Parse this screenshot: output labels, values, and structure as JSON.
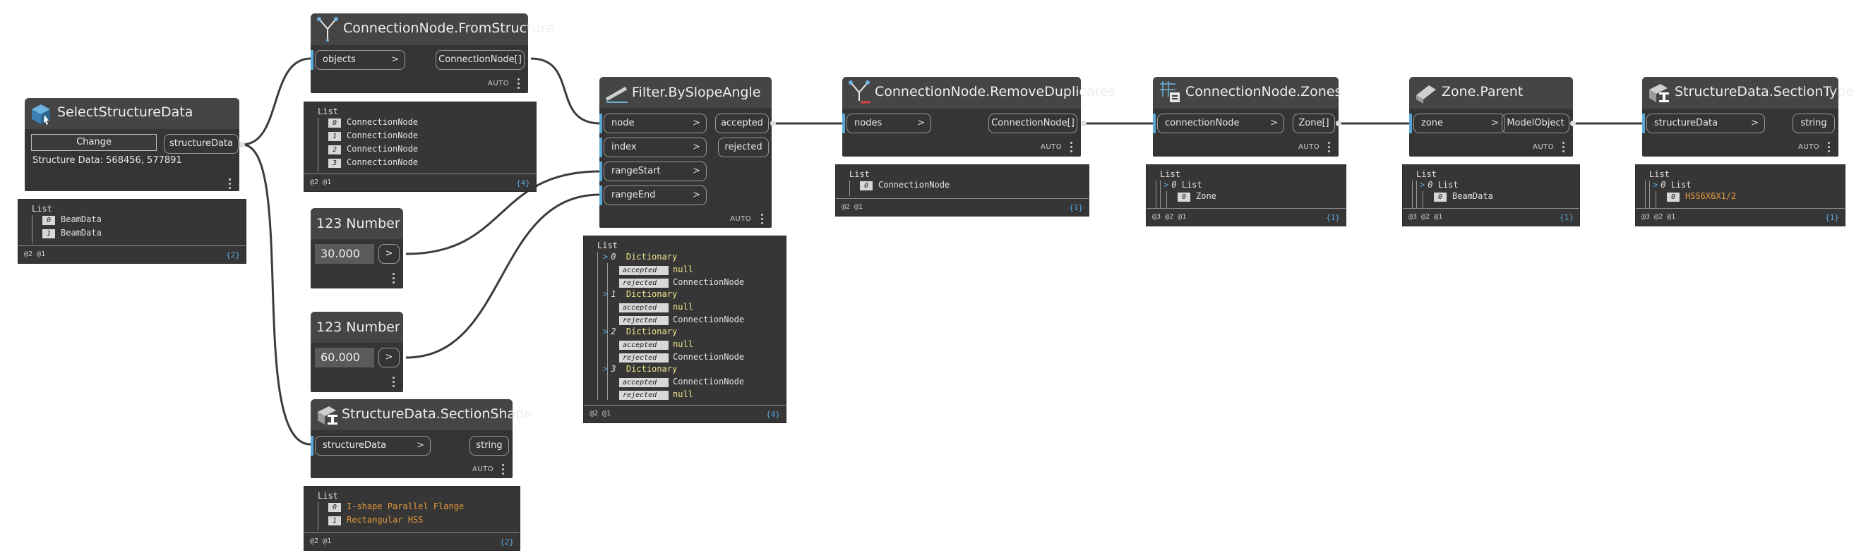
{
  "nodes": {
    "select_structure": {
      "title": "SelectStructureData",
      "button": "Change",
      "output": "structureData",
      "info": "Structure Data: 568456, 577891"
    },
    "from_structure": {
      "title": "ConnectionNode.FromStructure",
      "input": "objects",
      "output": "ConnectionNode[]",
      "lacing": "AUTO"
    },
    "number1": {
      "title": "123 Number",
      "value": "30.000",
      "output": ">"
    },
    "number2": {
      "title": "123 Number",
      "value": "60.000",
      "output": ">"
    },
    "section_shape": {
      "title": "StructureData.SectionShape",
      "input": "structureData",
      "output": "string",
      "lacing": "AUTO"
    },
    "filter": {
      "title": "Filter.BySlopeAngle",
      "inputs": [
        "node",
        "index",
        "rangeStart",
        "rangeEnd"
      ],
      "outputs": [
        "accepted",
        "rejected"
      ],
      "lacing": "AUTO"
    },
    "remove_dups": {
      "title": "ConnectionNode.RemoveDuplicates",
      "input": "nodes",
      "output": "ConnectionNode[]",
      "lacing": "AUTO"
    },
    "zones": {
      "title": "ConnectionNode.Zones",
      "input": "connectionNode",
      "output": "Zone[]",
      "lacing": "AUTO"
    },
    "zone_parent": {
      "title": "Zone.Parent",
      "input": "zone",
      "output": "ModelObject",
      "lacing": "AUTO"
    },
    "section_type": {
      "title": "StructureData.SectionType",
      "input": "structureData",
      "output": "string",
      "lacing": "AUTO"
    }
  },
  "previews": {
    "select_structure": {
      "list": "List",
      "items": [
        {
          "i": "0",
          "v": "BeamData"
        },
        {
          "i": "1",
          "v": "BeamData"
        }
      ],
      "levels": "@2 @1",
      "count": "{2}"
    },
    "from_structure": {
      "list": "List",
      "items": [
        {
          "i": "0",
          "v": "ConnectionNode"
        },
        {
          "i": "1",
          "v": "ConnectionNode"
        },
        {
          "i": "2",
          "v": "ConnectionNode"
        },
        {
          "i": "3",
          "v": "ConnectionNode"
        }
      ],
      "levels": "@2 @1",
      "count": "{4}"
    },
    "section_shape": {
      "list": "List",
      "items": [
        {
          "i": "0",
          "v": "I-shape Parallel Flange"
        },
        {
          "i": "1",
          "v": "Rectangular HSS"
        }
      ],
      "levels": "@2 @1",
      "count": "{2}"
    },
    "filter": {
      "list": "List",
      "dicts": [
        {
          "i": "0",
          "label": "Dictionary",
          "rows": [
            {
              "k": "accepted",
              "v": "null"
            },
            {
              "k": "rejected",
              "v": "ConnectionNode"
            }
          ]
        },
        {
          "i": "1",
          "label": "Dictionary",
          "rows": [
            {
              "k": "accepted",
              "v": "null"
            },
            {
              "k": "rejected",
              "v": "ConnectionNode"
            }
          ]
        },
        {
          "i": "2",
          "label": "Dictionary",
          "rows": [
            {
              "k": "accepted",
              "v": "null"
            },
            {
              "k": "rejected",
              "v": "ConnectionNode"
            }
          ]
        },
        {
          "i": "3",
          "label": "Dictionary",
          "rows": [
            {
              "k": "accepted",
              "v": "ConnectionNode"
            },
            {
              "k": "rejected",
              "v": "null"
            }
          ]
        }
      ],
      "levels": "@2 @1",
      "count": "{4}"
    },
    "remove_dups": {
      "list": "List",
      "items": [
        {
          "i": "0",
          "v": "ConnectionNode"
        }
      ],
      "levels": "@2 @1",
      "count": "{1}"
    },
    "zones": {
      "list": "List",
      "sub": "List",
      "items": [
        {
          "i": "0",
          "v": "Zone"
        }
      ],
      "levels": "@3 @2 @1",
      "count": "{1}"
    },
    "zone_parent": {
      "list": "List",
      "sub": "List",
      "items": [
        {
          "i": "0",
          "v": "BeamData"
        }
      ],
      "levels": "@3 @2 @1",
      "count": "{1}"
    },
    "section_type": {
      "list": "List",
      "sub": "List",
      "items": [
        {
          "i": "0",
          "v": "HSS6X6X1/2"
        }
      ],
      "levels": "@3 @2 @1",
      "count": "{1}"
    }
  },
  "colors": {
    "canvas": "#ffffff",
    "node": "#353535",
    "header": "#454545",
    "accent": "#5ba7d8",
    "dict": "#f0e68c",
    "string": "#e69a3b"
  }
}
